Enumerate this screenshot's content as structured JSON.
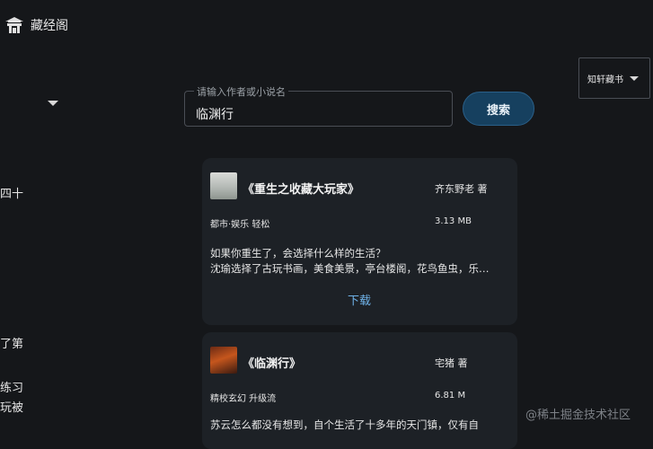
{
  "app": {
    "title": "藏经阁",
    "logo_icon": "pavilion-icon"
  },
  "sidebar_fragments": [
    {
      "text": "四十"
    },
    {
      "text": "了第"
    },
    {
      "text": "练习"
    },
    {
      "text": "玩被"
    }
  ],
  "search": {
    "label": "请输入作者或小说名",
    "value": "临渊行",
    "button_label": "搜索"
  },
  "source": {
    "label": "知轩藏书"
  },
  "books": [
    {
      "title": "《重生之收藏大玩家》",
      "author": "齐东野老 著",
      "tags": "都市·娱乐  轻松",
      "size": "3.13 MB",
      "description": "如果你重生了，会选择什么样的生活？\n沈瑜选择了古玩书画，美食美景，亭台楼阁，花鸟鱼虫，乐…",
      "download_label": "下载"
    },
    {
      "title": "《临渊行》",
      "author": "宅猪 著",
      "tags": "精校玄幻  升级流",
      "size": "6.81 M",
      "description": "苏云怎么都没有想到，自个生活了十多年的天门镇，仅有自"
    }
  ],
  "watermark": "@稀土掘金技术社区",
  "colors": {
    "accent": "#16405f",
    "link": "#6fb2e8",
    "background": "#15171a",
    "card": "#1d2126"
  }
}
